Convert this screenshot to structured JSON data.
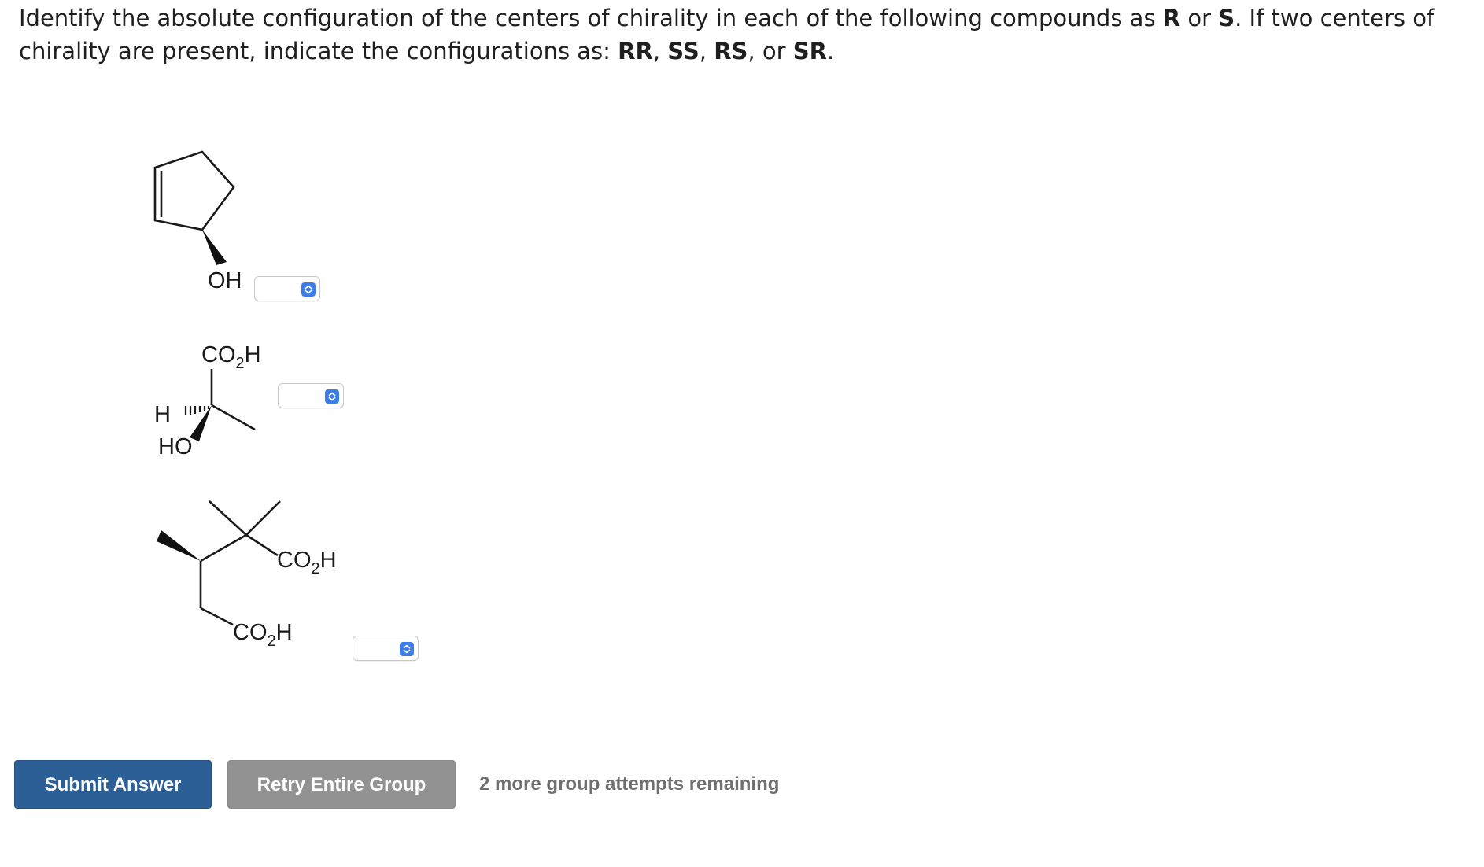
{
  "question": {
    "part1": "Identify the absolute configuration of the centers of chirality in each of the following compounds as ",
    "bold_r": "R",
    "part2": " or ",
    "bold_s": "S",
    "part3": ". If two centers of chirality are present, indicate the configurations as: ",
    "bold_rr": "RR",
    "sep1": ", ",
    "bold_ss": "SS",
    "sep2": ", ",
    "bold_rs": "RS",
    "part4": ", or ",
    "bold_sr": "SR",
    "part5": "."
  },
  "compounds": [
    {
      "labels": {
        "oh": "OH"
      },
      "select_value": ""
    },
    {
      "labels": {
        "co": "CO",
        "sub": "2",
        "h": "H",
        "h_left": "H",
        "ho": "HO"
      },
      "select_value": ""
    },
    {
      "labels": {
        "co_a": "CO",
        "sub_a": "2",
        "h_a": "H",
        "co_b": "CO",
        "sub_b": "2",
        "h_b": "H"
      },
      "select_value": ""
    }
  ],
  "buttons": {
    "submit": "Submit Answer",
    "retry": "Retry Entire Group"
  },
  "status": {
    "attempts": "2 more group attempts remaining"
  },
  "colors": {
    "submit_bg": "#2d5f97",
    "retry_bg": "#929292",
    "select_arrow": "#3b7de9"
  }
}
